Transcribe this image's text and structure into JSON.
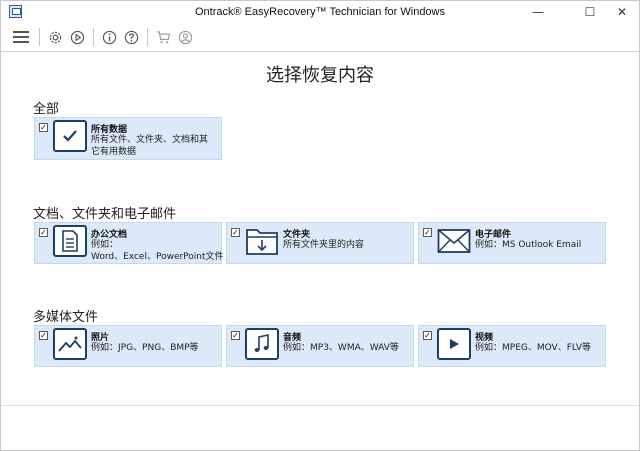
{
  "window": {
    "title": "Ontrack® EasyRecovery™ Technician for Windows",
    "minimize": "—",
    "maximize": "☐",
    "close": "✕"
  },
  "toolbar": {
    "icons": [
      "menu-icon",
      "settings-icon",
      "play-icon",
      "info-icon",
      "help-icon",
      "cart-icon",
      "user-icon"
    ]
  },
  "page": {
    "title": "选择恢复内容"
  },
  "sections": {
    "all": {
      "label": "全部",
      "cards": [
        {
          "title": "所有数据",
          "desc1": "所有文件、文件夹、文档和其",
          "desc2": "它有用数据",
          "icon": "checkmark-icon",
          "checked": "✓"
        }
      ]
    },
    "docs": {
      "label": "文档、文件夹和电子邮件",
      "cards": [
        {
          "title": "办公文档",
          "desc1": "例如：",
          "desc2": "Word、Excel、PowerPoint文件",
          "icon": "document-icon",
          "checked": "✓"
        },
        {
          "title": "文件夹",
          "desc1": "所有文件夹里的内容",
          "desc2": "",
          "icon": "folder-icon",
          "checked": "✓"
        },
        {
          "title": "电子邮件",
          "desc1": "例如：MS Outlook Email",
          "desc2": "",
          "icon": "mail-icon",
          "checked": "✓"
        }
      ]
    },
    "media": {
      "label": "多媒体文件",
      "cards": [
        {
          "title": "照片",
          "desc1": "例如：JPG、PNG、BMP等",
          "desc2": "",
          "icon": "photo-icon",
          "checked": "✓"
        },
        {
          "title": "音频",
          "desc1": "例如：MP3、WMA、WAV等",
          "desc2": "",
          "icon": "music-icon",
          "checked": "✓"
        },
        {
          "title": "视频",
          "desc1": "例如：MPEG、MOV、FLV等",
          "desc2": "",
          "icon": "video-icon",
          "checked": "✓"
        }
      ]
    }
  },
  "colors": {
    "card_bg": "#dbe9f8",
    "icon_stroke": "#1f3e66"
  }
}
